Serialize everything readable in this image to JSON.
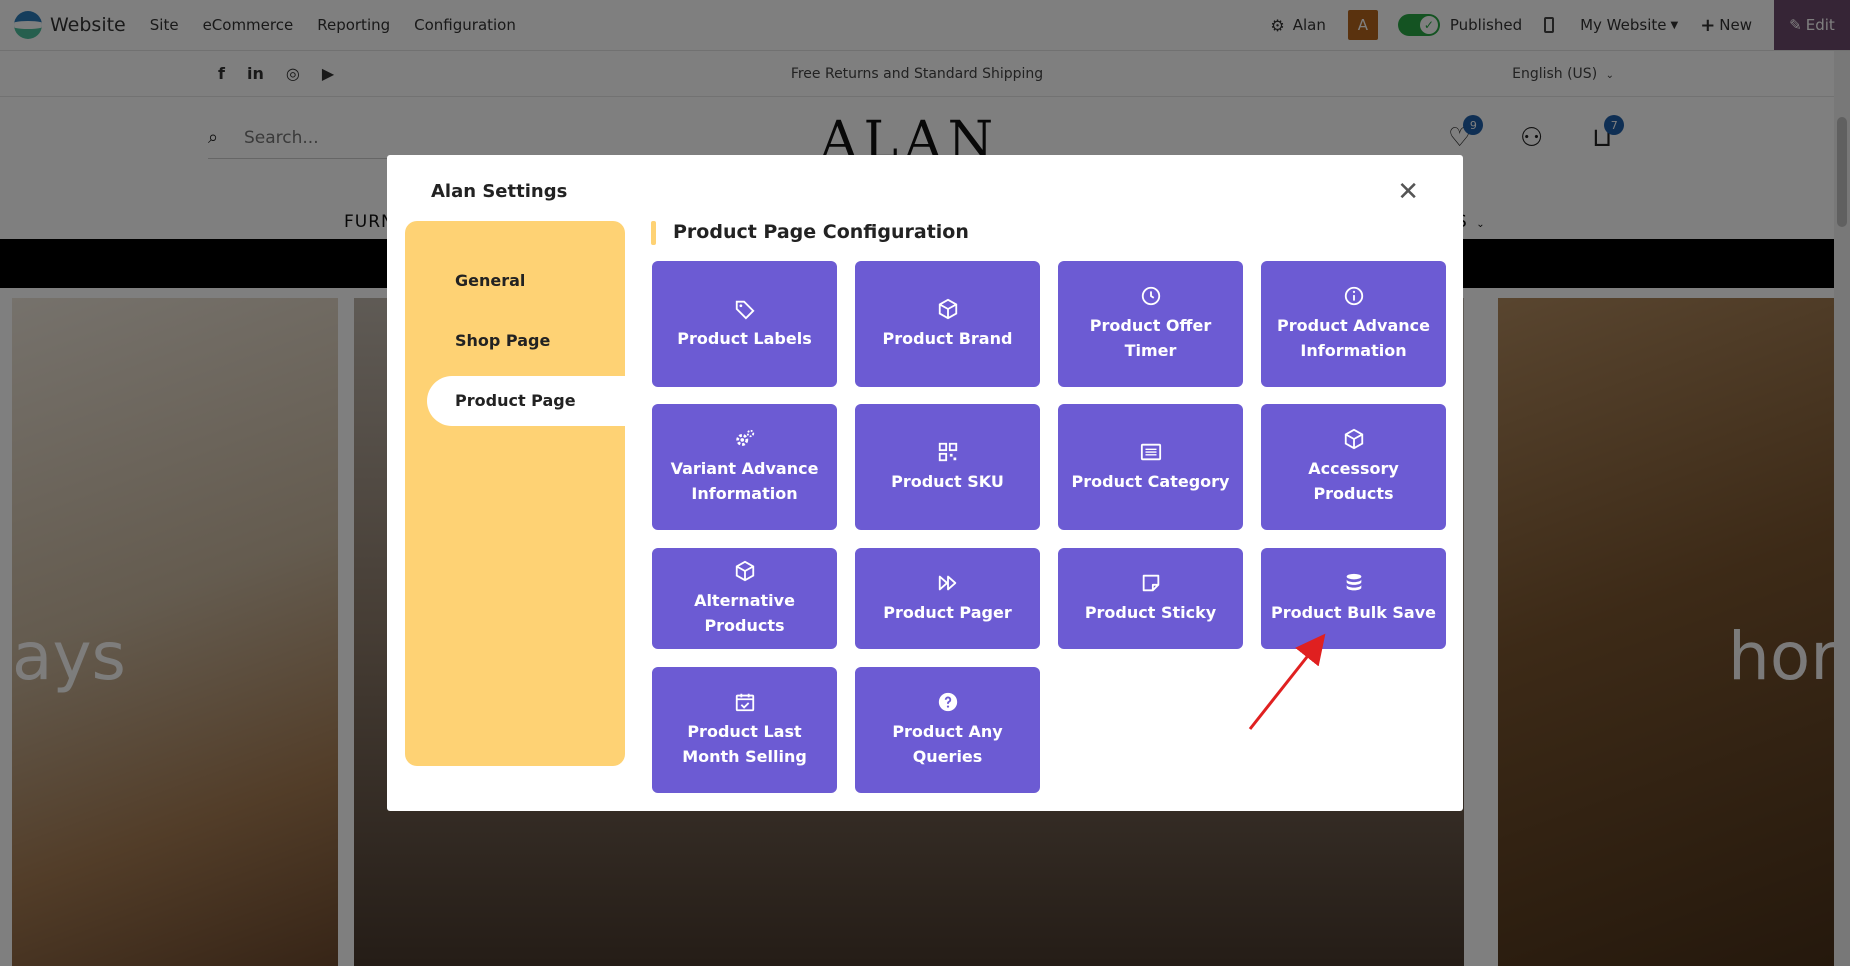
{
  "topbar": {
    "brand": "Website",
    "menu": [
      "Site",
      "eCommerce",
      "Reporting",
      "Configuration"
    ],
    "user": "Alan",
    "avatar_letter": "A",
    "published_label": "Published",
    "website_selector": "My Website",
    "new_label": "New",
    "edit_label": "Edit"
  },
  "site": {
    "announcement": "Free Returns and Standard Shipping",
    "language": "English (US)",
    "search_placeholder": "Search...",
    "logo": "ALAN",
    "wishlist_count": "9",
    "cart_count": "7",
    "nav_left": "FURN",
    "nav_right": "S",
    "panel_text_left": "ays",
    "panel_text_right": "hor"
  },
  "modal": {
    "title": "Alan Settings",
    "sidebar": {
      "items": [
        "General",
        "Shop Page",
        "Product Page"
      ],
      "active": "Product Page"
    },
    "section_title": "Product Page Configuration",
    "cards": [
      {
        "label": "Product Labels",
        "icon": "tag-icon"
      },
      {
        "label": "Product Brand",
        "icon": "cube-icon"
      },
      {
        "label": "Product Offer Timer",
        "icon": "clock-icon"
      },
      {
        "label": "Product Advance Information",
        "icon": "info-circle-icon"
      },
      {
        "label": "Variant Advance Information",
        "icon": "gears-icon"
      },
      {
        "label": "Product SKU",
        "icon": "qr-code-icon"
      },
      {
        "label": "Product Category",
        "icon": "list-icon"
      },
      {
        "label": "Accessory Products",
        "icon": "cube-icon"
      },
      {
        "label": "Alternative Products",
        "icon": "cube-icon"
      },
      {
        "label": "Product Pager",
        "icon": "fast-forward-icon"
      },
      {
        "label": "Product Sticky",
        "icon": "sticky-note-icon"
      },
      {
        "label": "Product Bulk Save",
        "icon": "database-icon"
      },
      {
        "label": "Product Last Month Selling",
        "icon": "calendar-check-icon"
      },
      {
        "label": "Product Any Queries",
        "icon": "question-circle-icon"
      }
    ]
  },
  "colors": {
    "card_bg": "#6c5bd3",
    "sidebar_bg": "#fed274",
    "annotation_arrow": "#e02020",
    "published_toggle": "#28a745"
  }
}
